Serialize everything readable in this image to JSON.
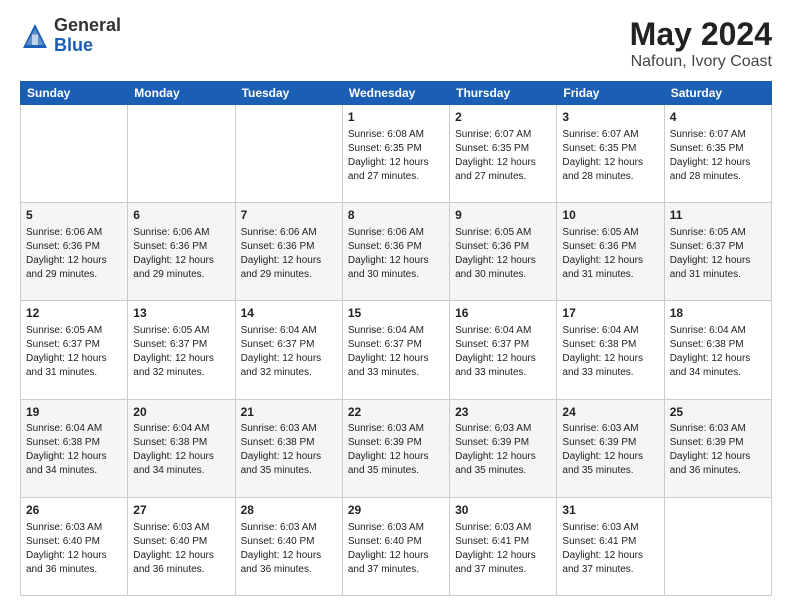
{
  "header": {
    "logo_general": "General",
    "logo_blue": "Blue",
    "month_year": "May 2024",
    "location": "Nafoun, Ivory Coast"
  },
  "weekdays": [
    "Sunday",
    "Monday",
    "Tuesday",
    "Wednesday",
    "Thursday",
    "Friday",
    "Saturday"
  ],
  "weeks": [
    [
      {
        "day": "",
        "info": ""
      },
      {
        "day": "",
        "info": ""
      },
      {
        "day": "",
        "info": ""
      },
      {
        "day": "1",
        "info": "Sunrise: 6:08 AM\nSunset: 6:35 PM\nDaylight: 12 hours\nand 27 minutes."
      },
      {
        "day": "2",
        "info": "Sunrise: 6:07 AM\nSunset: 6:35 PM\nDaylight: 12 hours\nand 27 minutes."
      },
      {
        "day": "3",
        "info": "Sunrise: 6:07 AM\nSunset: 6:35 PM\nDaylight: 12 hours\nand 28 minutes."
      },
      {
        "day": "4",
        "info": "Sunrise: 6:07 AM\nSunset: 6:35 PM\nDaylight: 12 hours\nand 28 minutes."
      }
    ],
    [
      {
        "day": "5",
        "info": "Sunrise: 6:06 AM\nSunset: 6:36 PM\nDaylight: 12 hours\nand 29 minutes."
      },
      {
        "day": "6",
        "info": "Sunrise: 6:06 AM\nSunset: 6:36 PM\nDaylight: 12 hours\nand 29 minutes."
      },
      {
        "day": "7",
        "info": "Sunrise: 6:06 AM\nSunset: 6:36 PM\nDaylight: 12 hours\nand 29 minutes."
      },
      {
        "day": "8",
        "info": "Sunrise: 6:06 AM\nSunset: 6:36 PM\nDaylight: 12 hours\nand 30 minutes."
      },
      {
        "day": "9",
        "info": "Sunrise: 6:05 AM\nSunset: 6:36 PM\nDaylight: 12 hours\nand 30 minutes."
      },
      {
        "day": "10",
        "info": "Sunrise: 6:05 AM\nSunset: 6:36 PM\nDaylight: 12 hours\nand 31 minutes."
      },
      {
        "day": "11",
        "info": "Sunrise: 6:05 AM\nSunset: 6:37 PM\nDaylight: 12 hours\nand 31 minutes."
      }
    ],
    [
      {
        "day": "12",
        "info": "Sunrise: 6:05 AM\nSunset: 6:37 PM\nDaylight: 12 hours\nand 31 minutes."
      },
      {
        "day": "13",
        "info": "Sunrise: 6:05 AM\nSunset: 6:37 PM\nDaylight: 12 hours\nand 32 minutes."
      },
      {
        "day": "14",
        "info": "Sunrise: 6:04 AM\nSunset: 6:37 PM\nDaylight: 12 hours\nand 32 minutes."
      },
      {
        "day": "15",
        "info": "Sunrise: 6:04 AM\nSunset: 6:37 PM\nDaylight: 12 hours\nand 33 minutes."
      },
      {
        "day": "16",
        "info": "Sunrise: 6:04 AM\nSunset: 6:37 PM\nDaylight: 12 hours\nand 33 minutes."
      },
      {
        "day": "17",
        "info": "Sunrise: 6:04 AM\nSunset: 6:38 PM\nDaylight: 12 hours\nand 33 minutes."
      },
      {
        "day": "18",
        "info": "Sunrise: 6:04 AM\nSunset: 6:38 PM\nDaylight: 12 hours\nand 34 minutes."
      }
    ],
    [
      {
        "day": "19",
        "info": "Sunrise: 6:04 AM\nSunset: 6:38 PM\nDaylight: 12 hours\nand 34 minutes."
      },
      {
        "day": "20",
        "info": "Sunrise: 6:04 AM\nSunset: 6:38 PM\nDaylight: 12 hours\nand 34 minutes."
      },
      {
        "day": "21",
        "info": "Sunrise: 6:03 AM\nSunset: 6:38 PM\nDaylight: 12 hours\nand 35 minutes."
      },
      {
        "day": "22",
        "info": "Sunrise: 6:03 AM\nSunset: 6:39 PM\nDaylight: 12 hours\nand 35 minutes."
      },
      {
        "day": "23",
        "info": "Sunrise: 6:03 AM\nSunset: 6:39 PM\nDaylight: 12 hours\nand 35 minutes."
      },
      {
        "day": "24",
        "info": "Sunrise: 6:03 AM\nSunset: 6:39 PM\nDaylight: 12 hours\nand 35 minutes."
      },
      {
        "day": "25",
        "info": "Sunrise: 6:03 AM\nSunset: 6:39 PM\nDaylight: 12 hours\nand 36 minutes."
      }
    ],
    [
      {
        "day": "26",
        "info": "Sunrise: 6:03 AM\nSunset: 6:40 PM\nDaylight: 12 hours\nand 36 minutes."
      },
      {
        "day": "27",
        "info": "Sunrise: 6:03 AM\nSunset: 6:40 PM\nDaylight: 12 hours\nand 36 minutes."
      },
      {
        "day": "28",
        "info": "Sunrise: 6:03 AM\nSunset: 6:40 PM\nDaylight: 12 hours\nand 36 minutes."
      },
      {
        "day": "29",
        "info": "Sunrise: 6:03 AM\nSunset: 6:40 PM\nDaylight: 12 hours\nand 37 minutes."
      },
      {
        "day": "30",
        "info": "Sunrise: 6:03 AM\nSunset: 6:41 PM\nDaylight: 12 hours\nand 37 minutes."
      },
      {
        "day": "31",
        "info": "Sunrise: 6:03 AM\nSunset: 6:41 PM\nDaylight: 12 hours\nand 37 minutes."
      },
      {
        "day": "",
        "info": ""
      }
    ]
  ]
}
